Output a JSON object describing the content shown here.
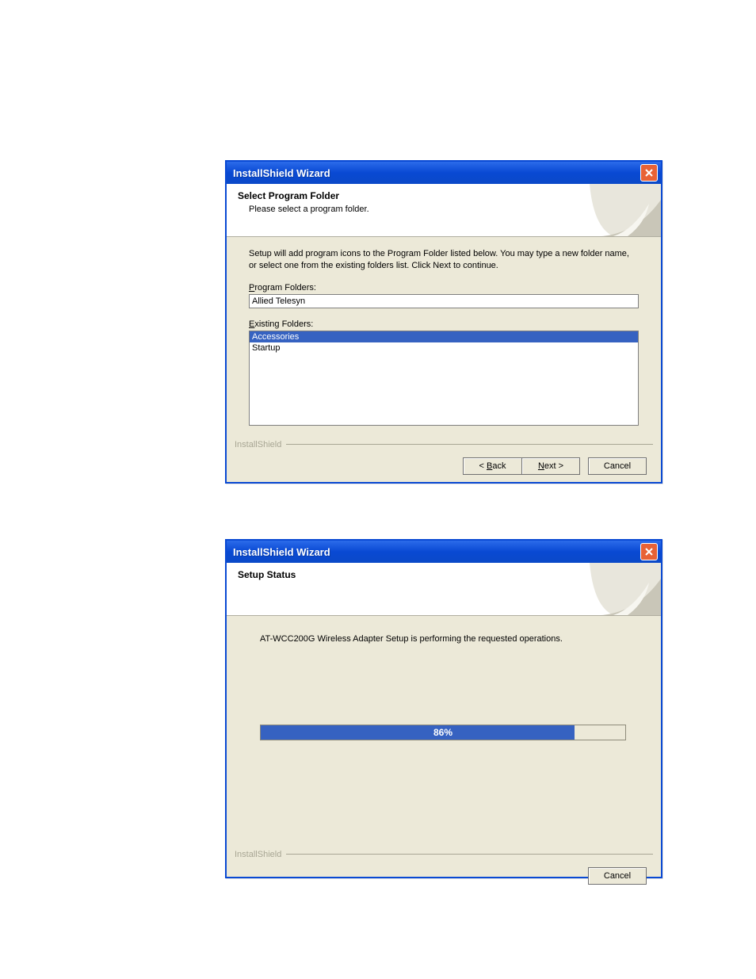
{
  "dialog1": {
    "title": "InstallShield Wizard",
    "header_title": "Select Program Folder",
    "header_sub": "Please select a program folder.",
    "instructions": "Setup will add program icons to the Program Folder listed below.  You may type a new folder name, or select one from the existing folders list.  Click Next to continue.",
    "label_program_folders_prefix": "P",
    "label_program_folders_rest": "rogram Folders:",
    "program_folder_value": "Allied Telesyn",
    "label_existing_folders_prefix": "E",
    "label_existing_folders_rest": "xisting Folders:",
    "existing_folders": [
      "Accessories",
      "Startup"
    ],
    "selected_index": 0,
    "brand": "InstallShield",
    "btn_back_prefix": "< ",
    "btn_back_ul": "B",
    "btn_back_rest": "ack",
    "btn_next_ul": "N",
    "btn_next_rest": "ext >",
    "btn_cancel": "Cancel"
  },
  "dialog2": {
    "title": "InstallShield Wizard",
    "header_title": "Setup Status",
    "status_text": "AT-WCC200G Wireless Adapter Setup is performing the requested operations.",
    "progress_percent": 86,
    "progress_label": "86%",
    "brand": "InstallShield",
    "btn_cancel": "Cancel"
  }
}
